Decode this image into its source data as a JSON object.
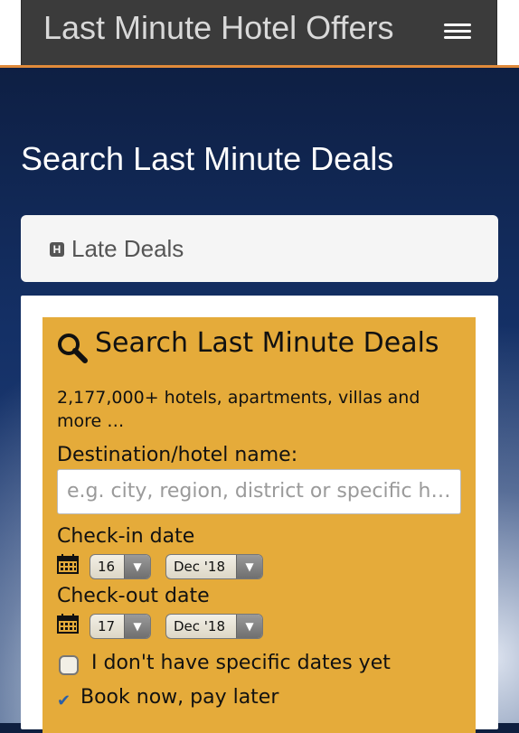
{
  "header": {
    "site_title": "Last Minute Hotel Offers",
    "menu_icon": "hamburger-menu-icon"
  },
  "hero": {
    "title": "Search Last Minute Deals"
  },
  "tab": {
    "icon": "hotel-icon",
    "label": "Late Deals"
  },
  "search_panel": {
    "title": "Search Last Minute Deals",
    "subtitle": "2,177,000+ hotels, apartments, villas and more …",
    "destination_label": "Destination/hotel name:",
    "destination_placeholder": "e.g. city, region, district or specific hotel",
    "checkin_label": "Check-in date",
    "checkin_day": "16",
    "checkin_month": "Dec '18",
    "checkout_label": "Check-out date",
    "checkout_day": "17",
    "checkout_month": "Dec '18",
    "no_dates_label": "I don't have specific dates yet",
    "book_now_label": "Book now, pay later"
  },
  "colors": {
    "panel_bg": "#e5ab3a",
    "header_bg": "#3b3b3b",
    "accent_border": "#e08a3a"
  }
}
